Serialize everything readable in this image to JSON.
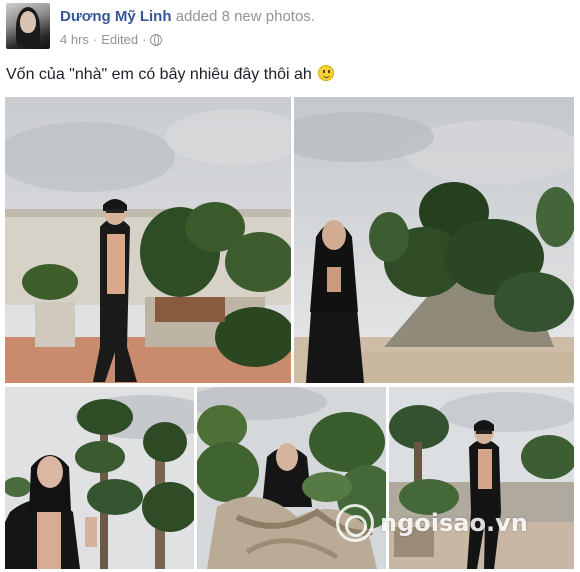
{
  "post": {
    "author": "Dương Mỹ Linh",
    "action": "added 8 new photos.",
    "time": "4 hrs",
    "separator": "·",
    "edited": "Edited",
    "separator2": "·",
    "privacy_icon": "globe-icon",
    "status_text": "Vốn của \"nhà\" em có bây nhiêu đây thôi ah",
    "emoji_icon": "smiley-icon"
  },
  "photos": [
    {
      "subject": "woman in sunglasses and black blazer standing beside bonsai trees"
    },
    {
      "subject": "woman in black seated in front of a large bonsai tree"
    },
    {
      "subject": "smiling woman beside tall topiary trees"
    },
    {
      "subject": "woman behind a large driftwood bonsai"
    },
    {
      "subject": "woman in sunglasses walking among bonsai pots"
    }
  ],
  "watermark": {
    "text": "ngoisao.vn",
    "logo_icon": "ngoisao-logo-icon"
  },
  "colors": {
    "link": "#365899",
    "meta": "#90949c",
    "text": "#1d2129"
  }
}
